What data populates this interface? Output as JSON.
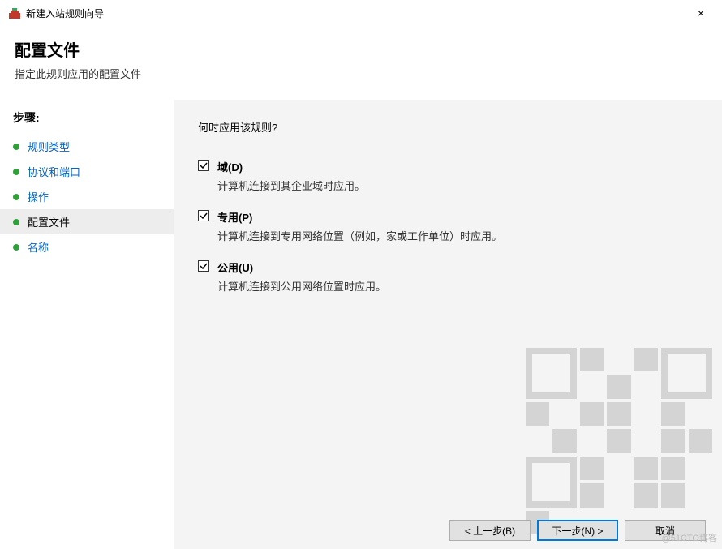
{
  "titlebar": {
    "title": "新建入站规则向导",
    "close": "×"
  },
  "header": {
    "title": "配置文件",
    "subtitle": "指定此规则应用的配置文件"
  },
  "sidebar": {
    "heading": "步骤:",
    "items": [
      {
        "label": "规则类型",
        "link": true
      },
      {
        "label": "协议和端口",
        "link": true
      },
      {
        "label": "操作",
        "link": true
      },
      {
        "label": "配置文件",
        "current": true
      },
      {
        "label": "名称",
        "link": true
      }
    ]
  },
  "main": {
    "question": "何时应用该规则?",
    "options": [
      {
        "label": "域(D)",
        "desc": "计算机连接到其企业域时应用。",
        "checked": true
      },
      {
        "label": "专用(P)",
        "desc": "计算机连接到专用网络位置（例如，家或工作单位）时应用。",
        "checked": true
      },
      {
        "label": "公用(U)",
        "desc": "计算机连接到公用网络位置时应用。",
        "checked": true
      }
    ]
  },
  "buttons": {
    "back": "< 上一步(B)",
    "next": "下一步(N) >",
    "cancel": "取消"
  },
  "watermark": "@51CTO博客"
}
